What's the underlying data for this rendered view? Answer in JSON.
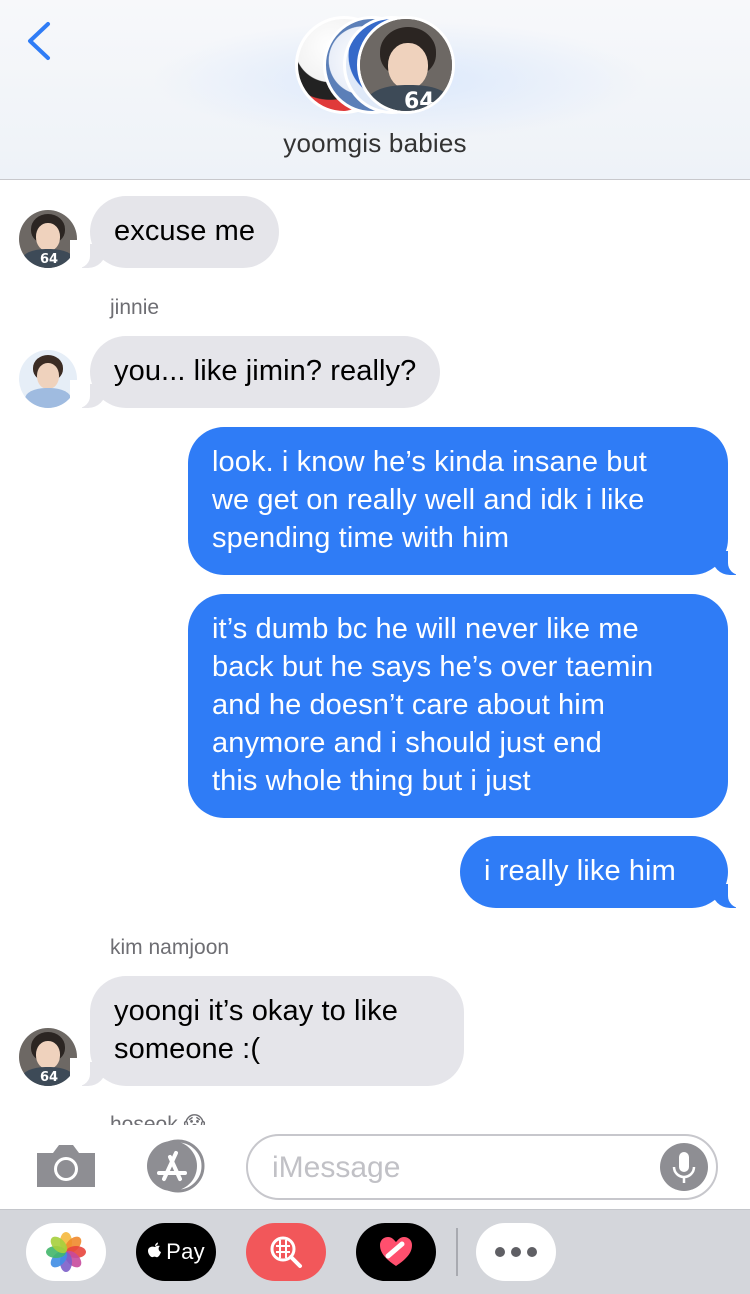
{
  "header": {
    "title": "yoomgis babies",
    "back_icon": "chevron-left-icon",
    "accent_color": "#2f7cf6"
  },
  "messages": [
    {
      "id": "m1",
      "direction": "incoming",
      "text": "excuse me"
    },
    {
      "id": "m2",
      "direction": "incoming",
      "sender": "jinnie",
      "text": "you... like jimin? really?"
    },
    {
      "id": "m3",
      "direction": "outgoing",
      "lines": [
        "look. i know he’s kinda insane but",
        "we get on really well and idk i like",
        "spending time with him"
      ]
    },
    {
      "id": "m4",
      "direction": "outgoing",
      "lines": [
        "it’s dumb bc he will never like me",
        "back but he says he’s over taemin",
        "and he doesn’t care about him",
        "anymore and i should just end",
        "this whole thing but i just"
      ]
    },
    {
      "id": "m5",
      "direction": "outgoing",
      "text": "i really like him"
    },
    {
      "id": "m6",
      "direction": "incoming",
      "sender": "kim namjoon",
      "lines": [
        "yoongi it’s okay to like",
        "someone :("
      ]
    }
  ],
  "partial_sender": "hoseok 😱",
  "input_bar": {
    "placeholder": "iMessage",
    "camera_icon": "camera-icon",
    "apps_icon": "app-store-icon",
    "mic_icon": "microphone-icon"
  },
  "app_drawer": {
    "photos_icon": "photos-icon",
    "pay_label": "Pay",
    "search_icon": "image-search-icon",
    "digital_touch_icon": "digital-touch-icon",
    "more_icon": "more-icon"
  }
}
